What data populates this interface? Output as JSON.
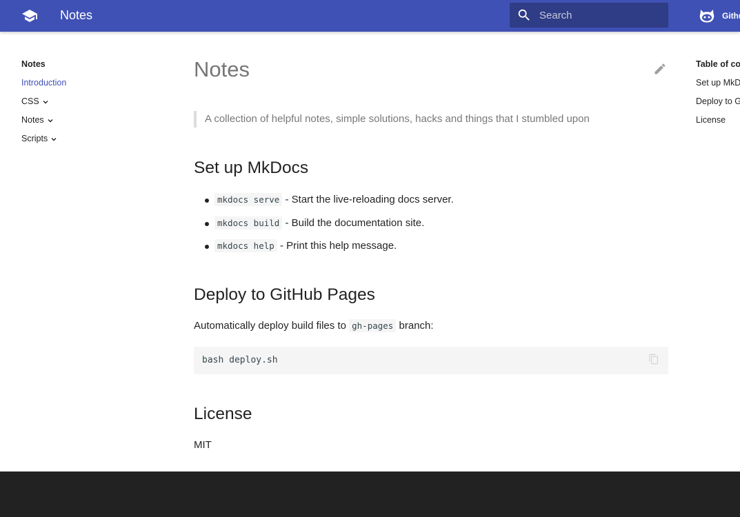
{
  "header": {
    "title": "Notes",
    "search_placeholder": "Search",
    "repo_label": "Github",
    "logo_icon": "school-icon",
    "accent_color": "#4051b5"
  },
  "nav": {
    "title": "Notes",
    "items": [
      {
        "label": "Introduction",
        "active": true
      },
      {
        "label": "CSS",
        "expandable": true
      },
      {
        "label": "Notes",
        "expandable": true
      },
      {
        "label": "Scripts",
        "expandable": true
      }
    ]
  },
  "content": {
    "title": "Notes",
    "description": "A collection of helpful notes, simple solutions, hacks and things that I stumbled upon",
    "sections": {
      "setup": {
        "heading": "Set up MkDocs",
        "items": [
          {
            "code": "mkdocs serve",
            "text": " - Start the live-reloading docs server."
          },
          {
            "code": "mkdocs build",
            "text": " - Build the documentation site."
          },
          {
            "code": "mkdocs help",
            "text": " - Print this help message."
          }
        ]
      },
      "deploy": {
        "heading": "Deploy to GitHub Pages",
        "text_before": "Automatically deploy build files to ",
        "code": "gh-pages",
        "text_after": " branch:",
        "codeblock": "bash deploy.sh"
      },
      "license": {
        "heading": "License",
        "text": "MIT"
      }
    }
  },
  "toc": {
    "title": "Table of contents",
    "items": [
      "Set up MkDocs",
      "Deploy to GitHub Pages",
      "License"
    ]
  }
}
